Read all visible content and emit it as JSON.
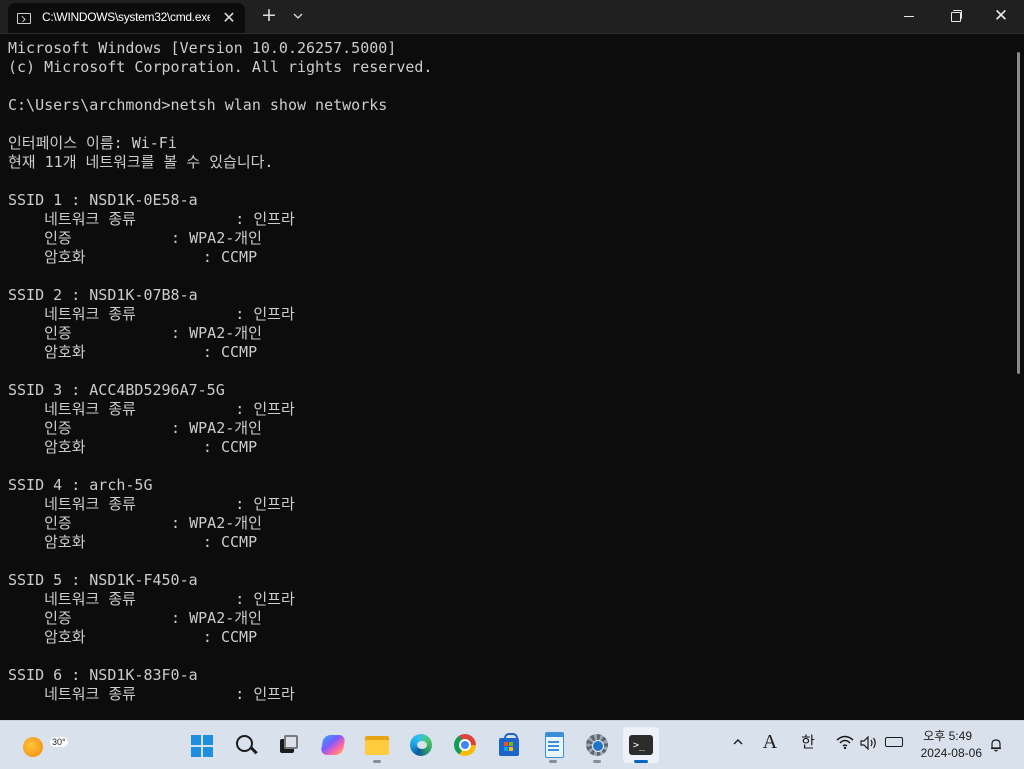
{
  "window": {
    "tab_title": "C:\\WINDOWS\\system32\\cmd.exe",
    "tab_close": "✕",
    "new_tab": "+",
    "dropdown": "⌄",
    "minimize": "minimize",
    "maximize": "maximize",
    "close": "✕"
  },
  "console": {
    "text": "Microsoft Windows [Version 10.0.26257.5000]\n(c) Microsoft Corporation. All rights reserved.\n\nC:\\Users\\archmond>netsh wlan show networks\n\n인터페이스 이름: Wi-Fi\n현재 11개 네트워크를 볼 수 있습니다.\n\nSSID 1 : NSD1K-0E58-a\n    네트워크 종류           : 인프라\n    인증           : WPA2-개인\n    암호화             : CCMP\n\nSSID 2 : NSD1K-07B8-a\n    네트워크 종류           : 인프라\n    인증           : WPA2-개인\n    암호화             : CCMP\n\nSSID 3 : ACC4BD5296A7-5G\n    네트워크 종류           : 인프라\n    인증           : WPA2-개인\n    암호화             : CCMP\n\nSSID 4 : arch-5G\n    네트워크 종류           : 인프라\n    인증           : WPA2-개인\n    암호화             : CCMP\n\nSSID 5 : NSD1K-F450-a\n    네트워크 종류           : 인프라\n    인증           : WPA2-개인\n    암호화             : CCMP\n\nSSID 6 : NSD1K-83F0-a\n    네트워크 종류           : 인프라"
  },
  "taskbar": {
    "weather_temp": "30°",
    "apps": [
      "start",
      "search",
      "task-view",
      "copilot",
      "file-explorer",
      "edge",
      "chrome",
      "microsoft-store",
      "notepad",
      "settings",
      "terminal"
    ],
    "tray": {
      "chevron": "^",
      "ime_mode": "A",
      "ime_lang": "한",
      "time": "오후 5:49",
      "date": "2024-08-06"
    }
  },
  "colors": {
    "console_bg": "#0c0c0c",
    "console_fg": "#cccccc",
    "titlebar_bg": "#202020",
    "taskbar_bg": "#d9e1ec",
    "accent": "#0067c0"
  }
}
